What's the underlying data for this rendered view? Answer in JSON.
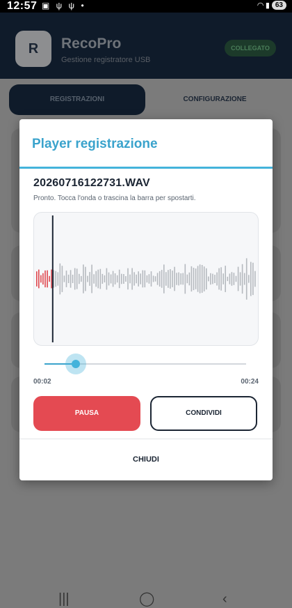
{
  "status_bar": {
    "time": "12:57",
    "notification_icons": "▣ ψ ψ •",
    "battery": "63"
  },
  "header": {
    "avatar_letter": "R",
    "app_name": "RecoPro",
    "subtitle": "Gestione registratore USB",
    "connection_status": "COLLEGATO"
  },
  "tabs": [
    {
      "label": "REGISTRAZIONI",
      "active": true
    },
    {
      "label": "CONFIGURAZIONE",
      "active": false
    }
  ],
  "dialog": {
    "title": "Player registrazione",
    "filename": "20260716122731.WAV",
    "hint": "Pronto. Tocca l'onda o trascina la barra per spostarti.",
    "elapsed": "00:02",
    "total": "00:24",
    "progress_fraction": 0.08,
    "pause_label": "PAUSA",
    "share_label": "CONDIVIDI",
    "close_label": "CHIUDI"
  },
  "colors": {
    "accent": "#44b3db",
    "played_wave": "#e0474e",
    "unplayed_wave": "#b5b9be",
    "pause_button": "#e44a52",
    "header_bg": "#0f1b2a"
  },
  "icons": {
    "nav_recent": "recent-apps-icon",
    "nav_home": "home-icon",
    "nav_back": "back-icon"
  }
}
